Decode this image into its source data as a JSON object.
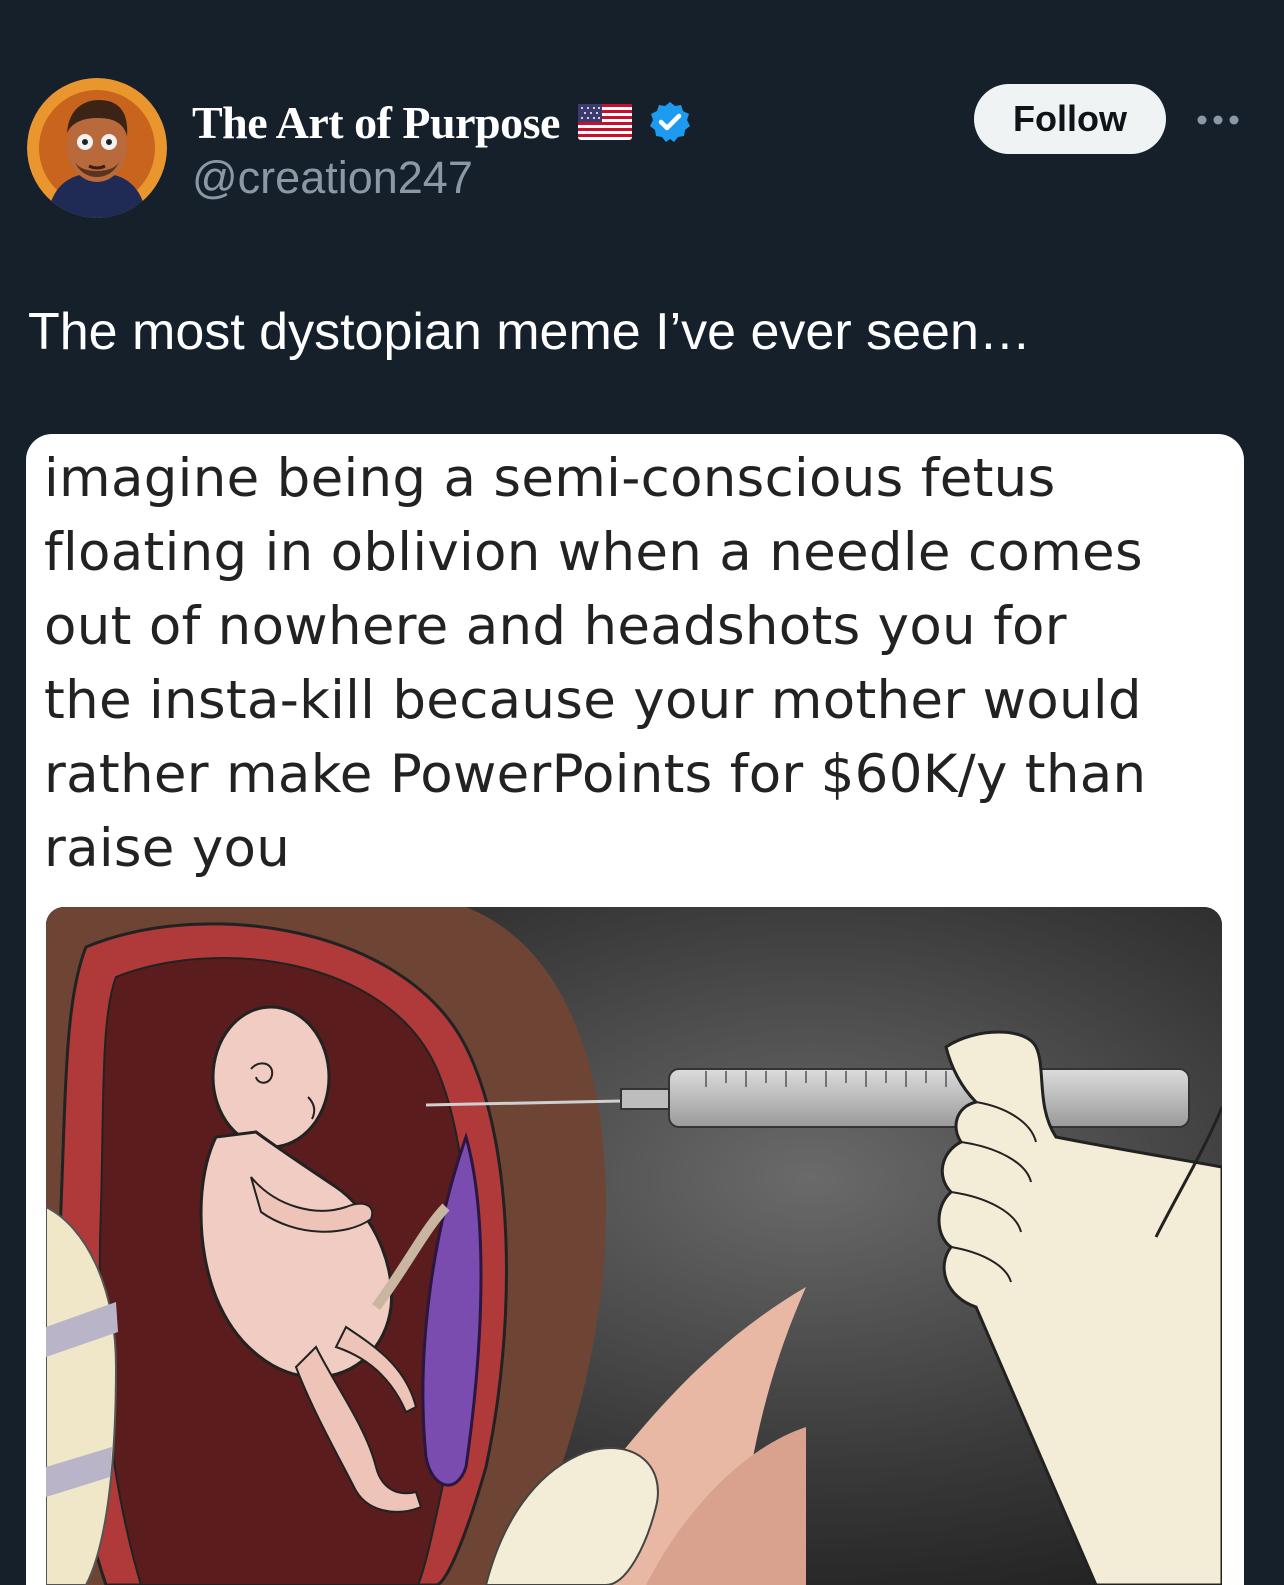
{
  "post": {
    "author": {
      "display_name": "The Art of Purpose",
      "handle": "@creation247",
      "flag_icon": "us-flag-icon",
      "verified_icon": "verified-badge-icon",
      "verified_color": "#1d9bf0"
    },
    "follow_label": "Follow",
    "more_icon": "more-options-icon",
    "text": "The most dystopian meme I’ve ever seen…",
    "media": {
      "caption_lines": [
        "imagine being a semi-conscious fetus",
        "floating in oblivion when a needle comes",
        "out of nowhere and headshots you for",
        "the insta-kill because your mother would",
        "rather make PowerPoints for $60K/y than",
        "raise you"
      ]
    }
  },
  "colors": {
    "background": "#15202b",
    "handle": "#8b98a5",
    "follow_bg": "#eff3f4"
  }
}
